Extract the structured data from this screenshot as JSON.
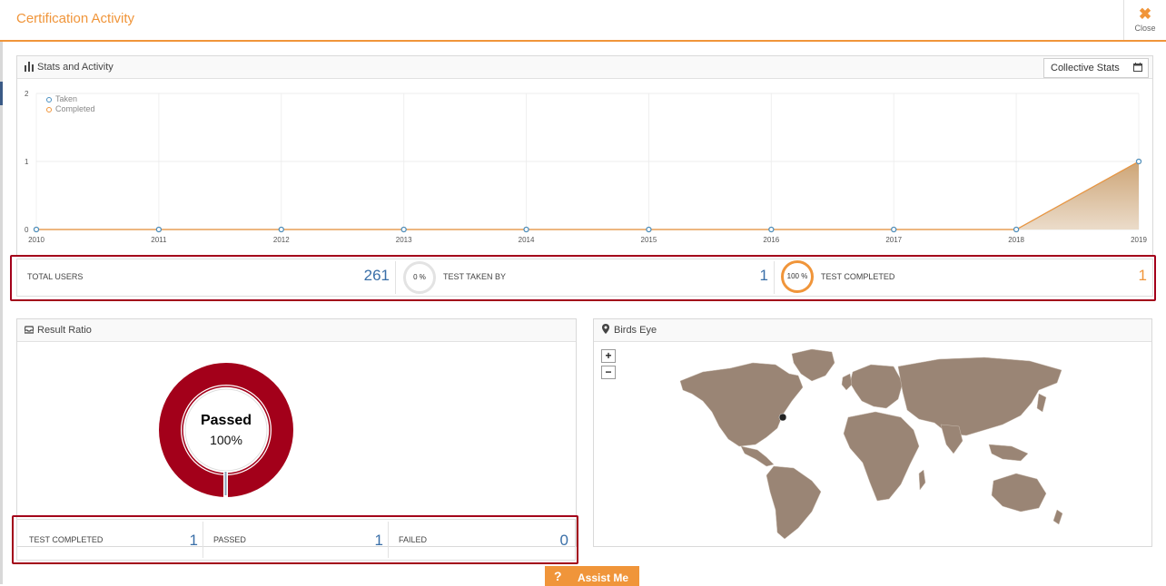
{
  "modal": {
    "title": "Certification Activity",
    "close_label": "Close"
  },
  "stats_panel": {
    "title": "Stats and Activity",
    "collective_label": "Collective Stats"
  },
  "chart_data": {
    "type": "area",
    "x": [
      "2010",
      "2011",
      "2012",
      "2013",
      "2014",
      "2015",
      "2016",
      "2017",
      "2018",
      "2019"
    ],
    "series": [
      {
        "name": "Taken",
        "values": [
          0,
          0,
          0,
          0,
          0,
          0,
          0,
          0,
          0,
          1
        ],
        "color": "#4a90c2"
      },
      {
        "name": "Completed",
        "values": [
          0,
          0,
          0,
          0,
          0,
          0,
          0,
          0,
          0,
          1
        ],
        "color": "#f0953a"
      }
    ],
    "y_ticks": [
      "0",
      "1",
      "2"
    ],
    "ylim": [
      0,
      2
    ],
    "grid": true,
    "legend": "top-left"
  },
  "summary": {
    "total_users_label": "TOTAL USERS",
    "total_users_value": "261",
    "taken_pct": "0 %",
    "taken_label": "TEST TAKEN BY",
    "taken_value": "1",
    "completed_pct": "100 %",
    "completed_label": "TEST COMPLETED",
    "completed_value": "1"
  },
  "result_panel": {
    "title": "Result Ratio",
    "donut_title": "Passed",
    "donut_value": "100%",
    "passed_fraction": 1.0,
    "donut_color": "#a3001a"
  },
  "result_stats": {
    "completed_label": "TEST COMPLETED",
    "completed_value": "1",
    "passed_label": "PASSED",
    "passed_value": "1",
    "failed_label": "FAILED",
    "failed_value": "0"
  },
  "birds_panel": {
    "title": "Birds Eye",
    "zoom_in": "+",
    "zoom_out": "−",
    "land_color": "#9a8575"
  },
  "assist": {
    "icon": "?",
    "label": "Assist Me"
  },
  "colors": {
    "accent": "#f0953a",
    "blue": "#3a6fa8",
    "red": "#a3001a"
  }
}
